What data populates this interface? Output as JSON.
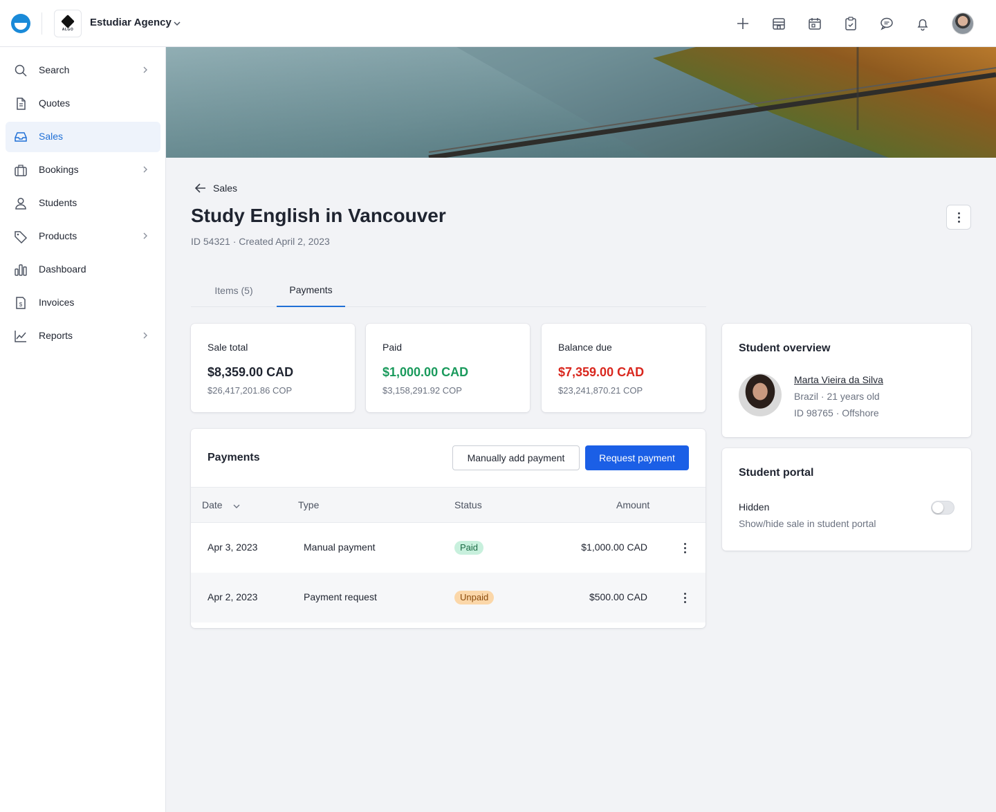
{
  "topbar": {
    "agency_name": "Estudiar Agency",
    "agency_logo_text": "ALGO",
    "icons": [
      "plus-icon",
      "storefront-icon",
      "calendar-icon",
      "clipboard-check-icon",
      "chat-icon",
      "bell-icon"
    ]
  },
  "sidebar": {
    "items": [
      {
        "label": "Search",
        "icon": "search-icon",
        "has_chevron": true
      },
      {
        "label": "Quotes",
        "icon": "document-icon",
        "has_chevron": false
      },
      {
        "label": "Sales",
        "icon": "inbox-icon",
        "has_chevron": false,
        "active": true
      },
      {
        "label": "Bookings",
        "icon": "briefcase-icon",
        "has_chevron": true
      },
      {
        "label": "Students",
        "icon": "user-icon",
        "has_chevron": false
      },
      {
        "label": "Products",
        "icon": "tag-icon",
        "has_chevron": true
      },
      {
        "label": "Dashboard",
        "icon": "bar-chart-icon",
        "has_chevron": false
      },
      {
        "label": "Invoices",
        "icon": "invoice-icon",
        "has_chevron": false
      },
      {
        "label": "Reports",
        "icon": "line-chart-icon",
        "has_chevron": true
      }
    ]
  },
  "breadcrumb": {
    "back_label": "Sales"
  },
  "page": {
    "title": "Study English in Vancouver",
    "meta": "ID 54321 · Created April 2, 2023"
  },
  "tabs": [
    {
      "label": "Items (5)",
      "active": false
    },
    {
      "label": "Payments",
      "active": true
    }
  ],
  "stats": [
    {
      "label": "Sale total",
      "value": "$8,359.00 CAD",
      "sub": "$26,417,201.86 COP",
      "color": "#1f2430"
    },
    {
      "label": "Paid",
      "value": "$1,000.00 CAD",
      "sub": "$3,158,291.92 COP",
      "color": "#1a9a5c"
    },
    {
      "label": "Balance due",
      "value": "$7,359.00 CAD",
      "sub": "$23,241,870.21 COP",
      "color": "#d9271e"
    }
  ],
  "payments": {
    "title": "Payments",
    "manual_button": "Manually add payment",
    "request_button": "Request payment",
    "columns": {
      "date": "Date",
      "type": "Type",
      "status": "Status",
      "amount": "Amount"
    },
    "rows": [
      {
        "date": "Apr 3, 2023",
        "type": "Manual payment",
        "status": "Paid",
        "status_kind": "paid",
        "amount": "$1,000.00 CAD"
      },
      {
        "date": "Apr 2, 2023",
        "type": "Payment request",
        "status": "Unpaid",
        "status_kind": "unpaid",
        "amount": "$500.00 CAD"
      }
    ]
  },
  "student_overview": {
    "title": "Student overview",
    "name": "Marta Vieira da Silva",
    "line1": "Brazil · 21 years old",
    "line2": "ID 98765 · Offshore"
  },
  "student_portal": {
    "title": "Student portal",
    "label": "Hidden",
    "sub": "Show/hide sale in student portal",
    "enabled": false
  },
  "colors": {
    "accent": "#1f6fd6",
    "primary_button": "#1b5fe6",
    "paid": "#1a9a5c",
    "due": "#d9271e"
  }
}
